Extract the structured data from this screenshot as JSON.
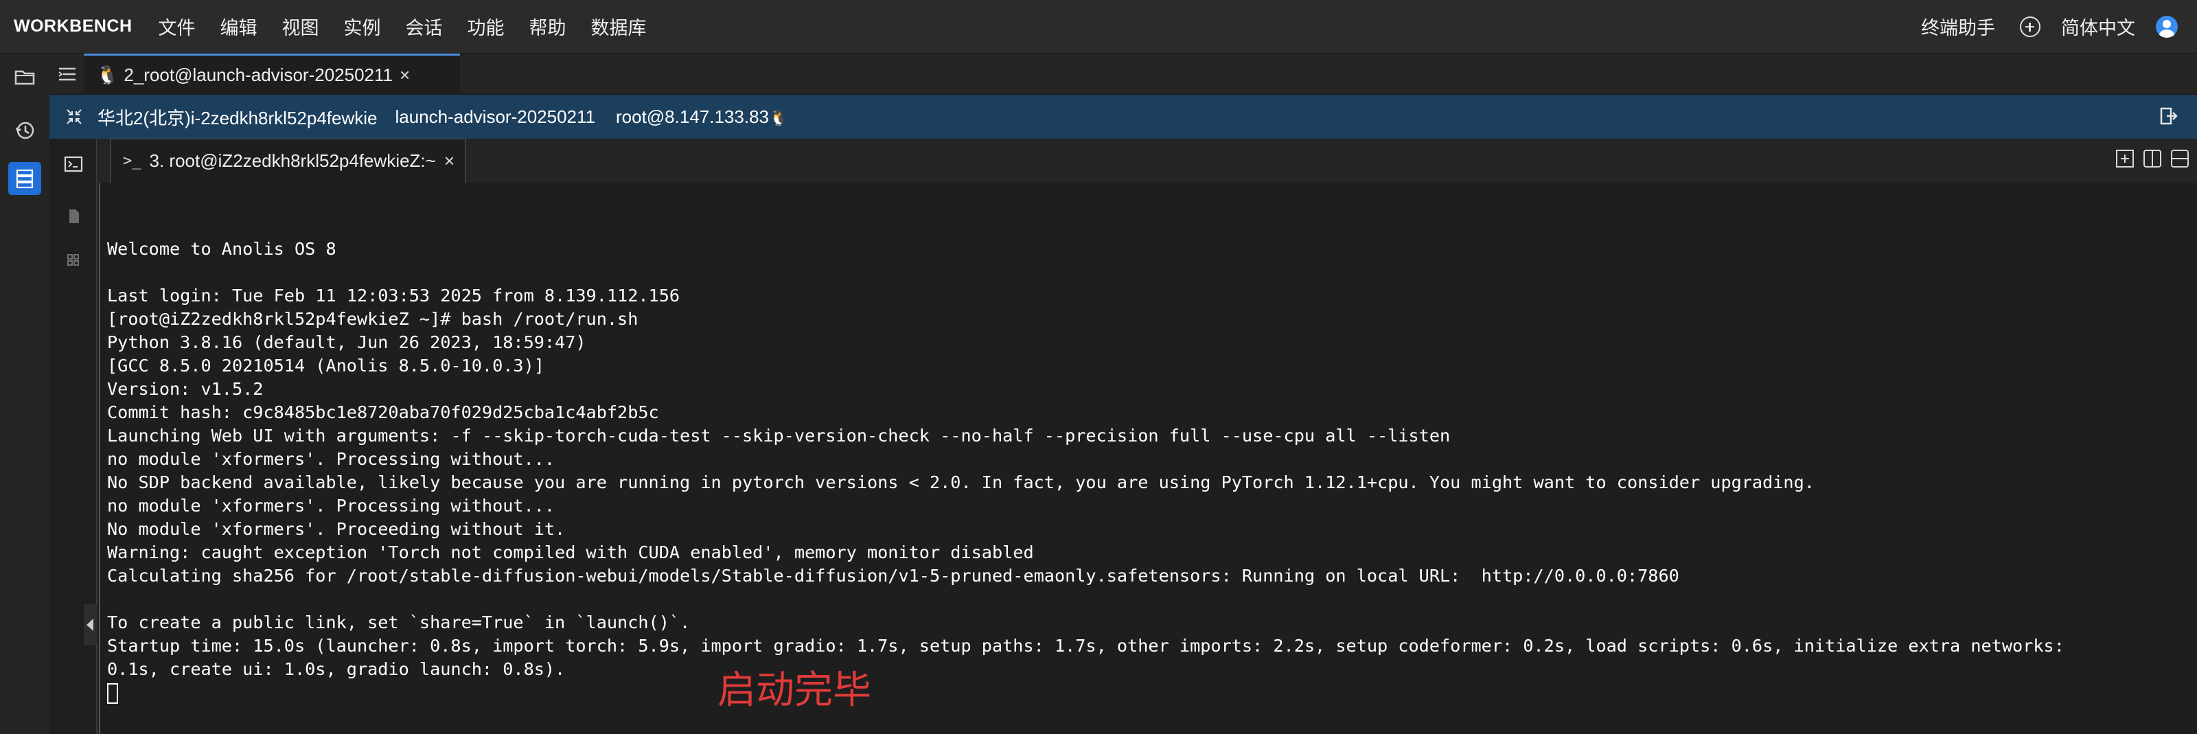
{
  "menubar": {
    "brand": "WORKBENCH",
    "items": [
      "文件",
      "编辑",
      "视图",
      "实例",
      "会话",
      "功能",
      "帮助",
      "数据库"
    ],
    "right": {
      "assistant": "终端助手",
      "language": "简体中文"
    }
  },
  "tabs": {
    "session_tab": "2_root@launch-advisor-20250211",
    "close_symbol": "×"
  },
  "infobar": {
    "region_instance": "华北2(北京)i-2zedkh8rkl52p4fewkie",
    "instance_name": "launch-advisor-20250211",
    "user_host": "root@8.147.133.83"
  },
  "terminal_tab": {
    "prompt_symbol": ">_",
    "label": "3. root@iZ2zedkh8rkl52p4fewkieZ:~"
  },
  "terminal": {
    "lines": [
      "",
      "Welcome to Anolis OS 8",
      "",
      "Last login: Tue Feb 11 12:03:53 2025 from 8.139.112.156",
      "[root@iZ2zedkh8rkl52p4fewkieZ ~]# bash /root/run.sh",
      "Python 3.8.16 (default, Jun 26 2023, 18:59:47)",
      "[GCC 8.5.0 20210514 (Anolis 8.5.0-10.0.3)]",
      "Version: v1.5.2",
      "Commit hash: c9c8485bc1e8720aba70f029d25cba1c4abf2b5c",
      "Launching Web UI with arguments: -f --skip-torch-cuda-test --skip-version-check --no-half --precision full --use-cpu all --listen",
      "no module 'xformers'. Processing without...",
      "No SDP backend available, likely because you are running in pytorch versions < 2.0. In fact, you are using PyTorch 1.12.1+cpu. You might want to consider upgrading.",
      "no module 'xformers'. Processing without...",
      "No module 'xformers'. Proceeding without it.",
      "Warning: caught exception 'Torch not compiled with CUDA enabled', memory monitor disabled",
      "Calculating sha256 for /root/stable-diffusion-webui/models/Stable-diffusion/v1-5-pruned-emaonly.safetensors: Running on local URL:  http://0.0.0.0:7860",
      "",
      "To create a public link, set `share=True` in `launch()`.",
      "Startup time: 15.0s (launcher: 0.8s, import torch: 5.9s, import gradio: 1.7s, setup paths: 1.7s, other imports: 2.2s, setup codeformer: 0.2s, load scripts: 0.6s, initialize extra networks:",
      "0.1s, create ui: 1.0s, gradio launch: 0.8s)."
    ]
  },
  "annotation": "启动完毕",
  "colors": {
    "accent_blue": "#1f6fd6",
    "infobar_bg": "#1d3f5e",
    "annotation_red": "#e03a3a"
  }
}
